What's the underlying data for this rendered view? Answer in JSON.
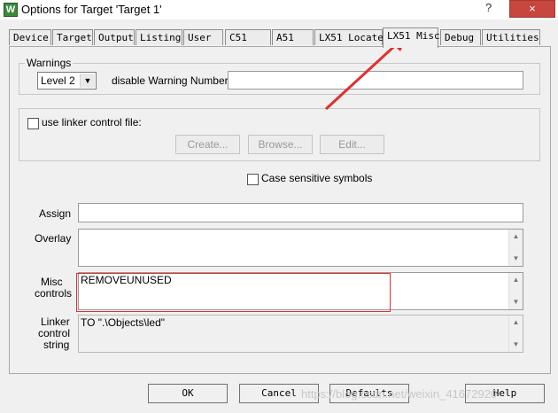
{
  "window": {
    "title": "Options for Target 'Target 1'",
    "app_icon_letter": "W",
    "help_glyph": "?",
    "close_glyph": "×"
  },
  "tabs": [
    {
      "label": "Device"
    },
    {
      "label": "Target"
    },
    {
      "label": "Output"
    },
    {
      "label": "Listing"
    },
    {
      "label": "User"
    },
    {
      "label": "C51"
    },
    {
      "label": "A51"
    },
    {
      "label": "LX51 Locate"
    },
    {
      "label": "LX51 Misc",
      "active": true
    },
    {
      "label": "Debug"
    },
    {
      "label": "Utilities"
    }
  ],
  "warnings": {
    "group_label": "Warnings",
    "level_value": "Level 2",
    "disable_label": "disable Warning Numbers:",
    "disable_value": ""
  },
  "linker_control": {
    "checkbox_label": "use linker control file:",
    "checked": false,
    "create_button": "Create...",
    "browse_button": "Browse...",
    "edit_button": "Edit..."
  },
  "case_sensitive": {
    "label": "Case sensitive symbols",
    "checked": false
  },
  "fields": {
    "assign_label": "Assign",
    "assign_value": "",
    "overlay_label": "Overlay",
    "overlay_value": "",
    "misc_label_1": "Misc",
    "misc_label_2": "controls",
    "misc_value": "REMOVEUNUSED",
    "linker_label_1": "Linker",
    "linker_label_2": "control",
    "linker_label_3": "string",
    "linker_value": "TO \".\\Objects\\led\""
  },
  "footer": {
    "ok_button": "OK",
    "cancel_button": "Cancel",
    "defaults_button": "Defaults",
    "help_button": "Help"
  },
  "watermark": "https://blog.csdn.net/weixin_41672920",
  "colors": {
    "annotation_red": "#e03030",
    "close_red": "#c7463d"
  }
}
